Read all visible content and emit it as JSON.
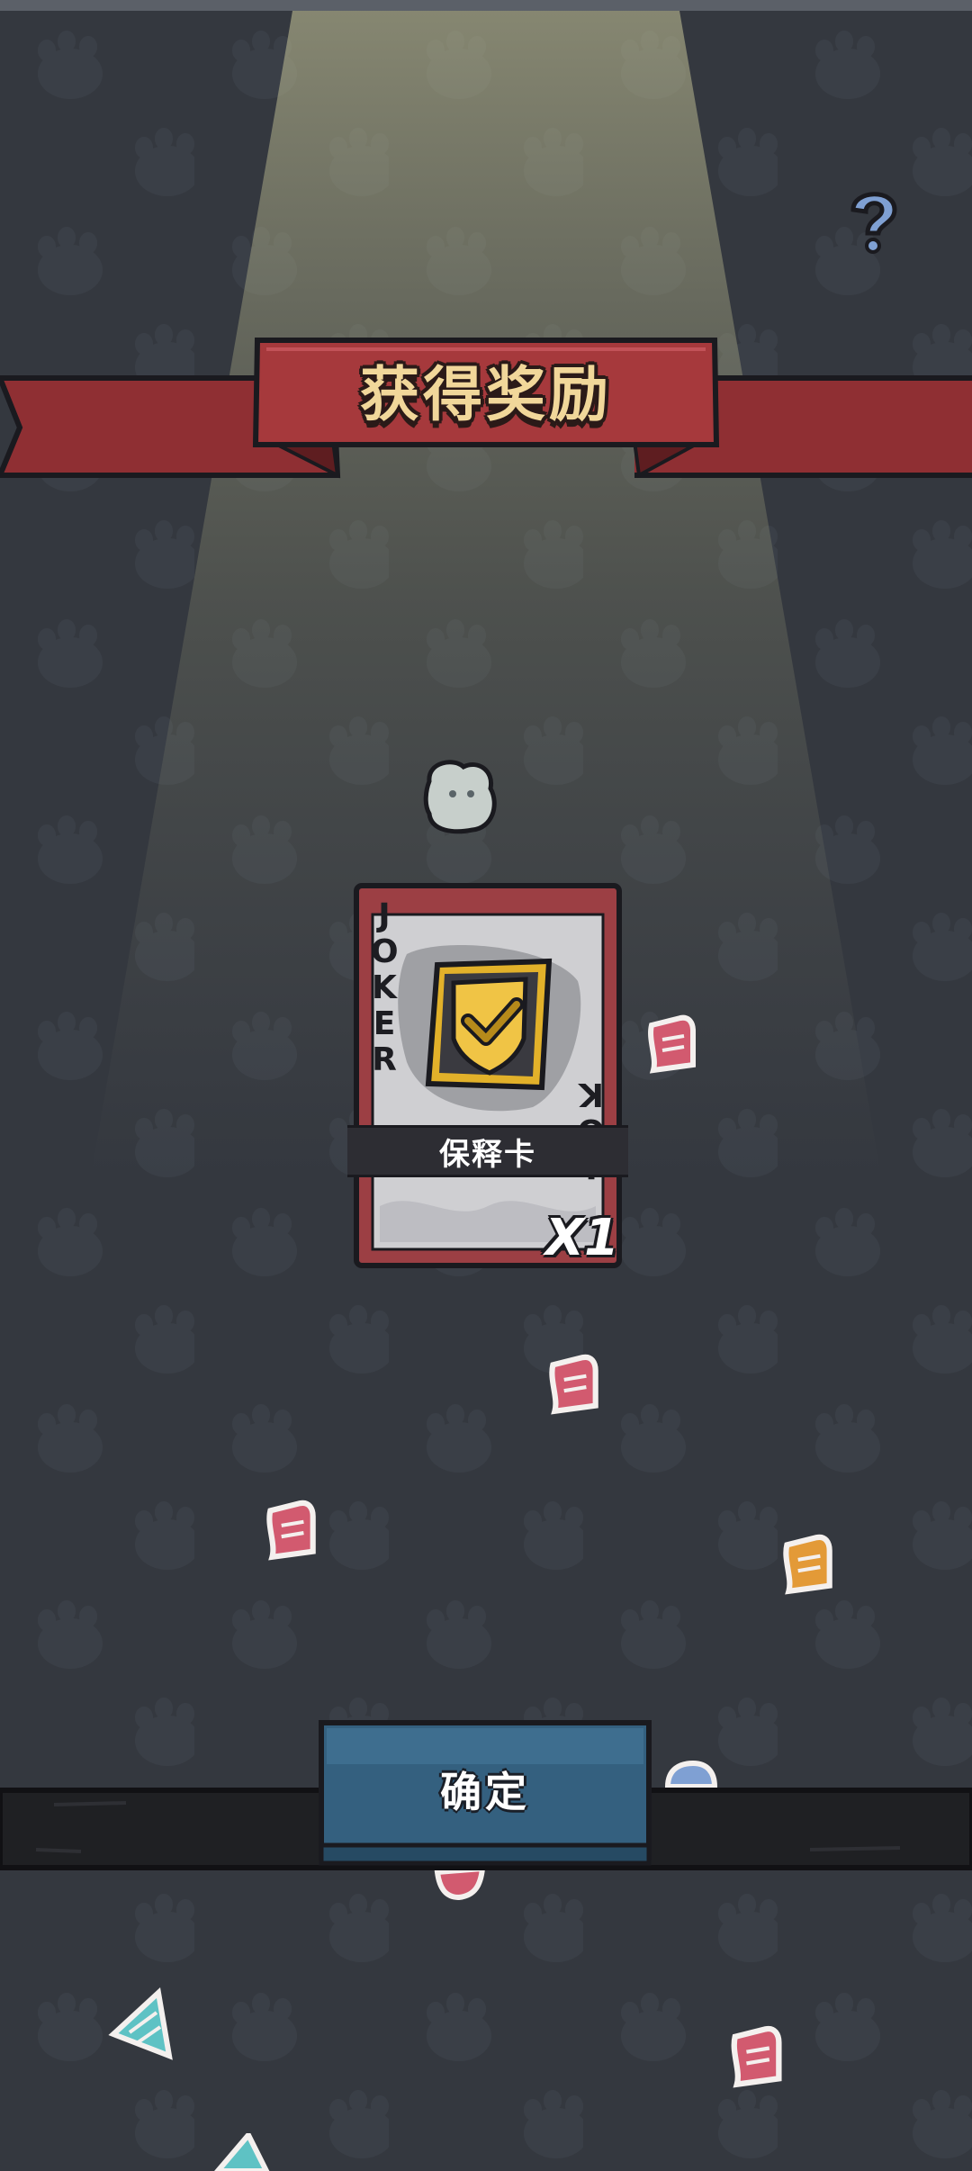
{
  "reward_banner": {
    "title": "获得奖励"
  },
  "reward_card": {
    "label_top": "JOKER",
    "label_bottom": "JOKER",
    "item_name": "保释卡",
    "quantity": "X1",
    "icon": "shield-check-icon"
  },
  "confirm_button": {
    "label": "确定"
  },
  "colors": {
    "background": "#34383f",
    "banner_red": "#a6393c",
    "card_red": "#9c3f44",
    "button_blue": "#34607f",
    "icon_gold": "#e2b12a"
  },
  "decorations": [
    "question-mark-confetti",
    "ghost-badge-confetti",
    "red-ticket-confetti",
    "orange-ticket-confetti",
    "blue-ticket-confetti",
    "teal-triangle-confetti"
  ]
}
